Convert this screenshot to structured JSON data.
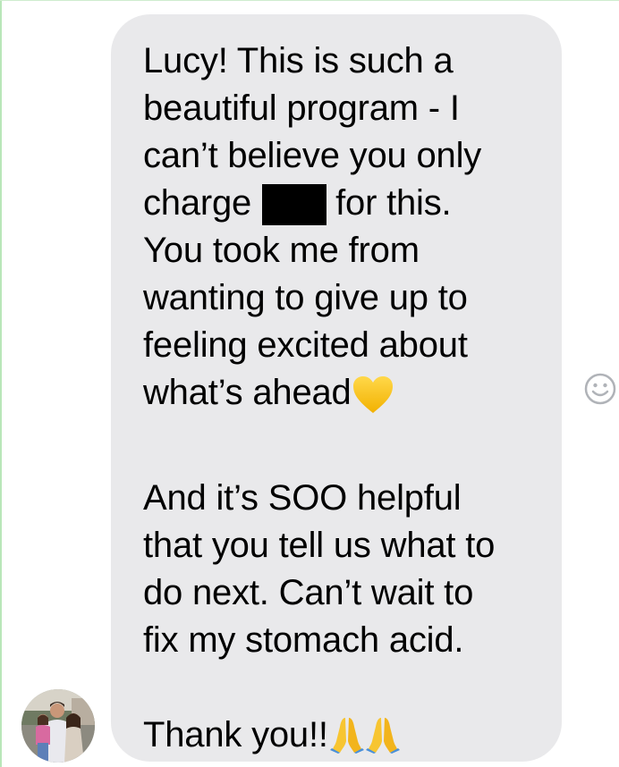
{
  "message": {
    "line_1": "Lucy! This is such a",
    "line_2": "beautiful program - I",
    "line_3": "can’t believe you only",
    "line_4_before": "charge",
    "line_4_after": "for this.",
    "line_5": "You took me from",
    "line_6": "wanting to give up to",
    "line_7": "feeling excited about",
    "line_8": "what’s ahead",
    "line_9": "And it’s SOO helpful",
    "line_10": "that you tell us what to",
    "line_11": "do next. Can’t wait to",
    "line_12": "fix my stomach acid.",
    "line_13": "Thank you!!"
  },
  "icons": {
    "heart": "yellow-heart-icon",
    "pray": "folded-hands-icon",
    "reaction": "smiley-face-icon",
    "avatar": "family-photo-avatar"
  },
  "colors": {
    "bubble": "#e9e9eb",
    "text": "#000000",
    "heart": "#f9c417",
    "reaction_icon": "#b0b3b8"
  }
}
